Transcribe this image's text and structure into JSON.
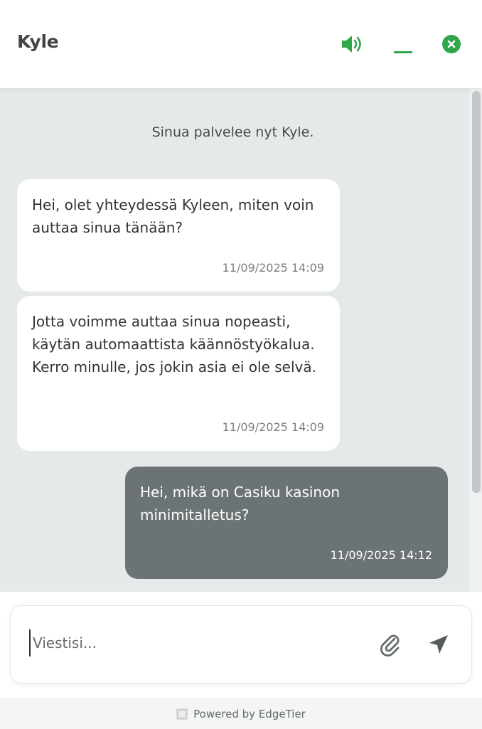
{
  "header": {
    "title": "Kyle",
    "accent_color": "#2fa74a",
    "icons": [
      "speaker-icon",
      "minimize-icon",
      "close-icon"
    ]
  },
  "chat": {
    "system_message": "Sinua palvelee nyt Kyle.",
    "messages": [
      {
        "sender": "agent",
        "text": "Hei, olet yhteydessä Kyleen, miten voin auttaa sinua tänään?",
        "time": "11/09/2025 14:09"
      },
      {
        "sender": "agent",
        "text": "Jotta voimme auttaa sinua nopeasti, käytän automaattista käännöstyökalua. Kerro minulle, jos jokin asia ei ole selvä.",
        "time": "11/09/2025 14:09"
      },
      {
        "sender": "user",
        "text": "Hei, mikä on Casiku kasinon minimitalletus?",
        "time": "11/09/2025 14:12"
      }
    ]
  },
  "composer": {
    "placeholder": "Viestisi...",
    "value": "",
    "icons": [
      "paperclip-icon",
      "send-icon"
    ]
  },
  "footer": {
    "text": "Powered by EdgeTier"
  }
}
